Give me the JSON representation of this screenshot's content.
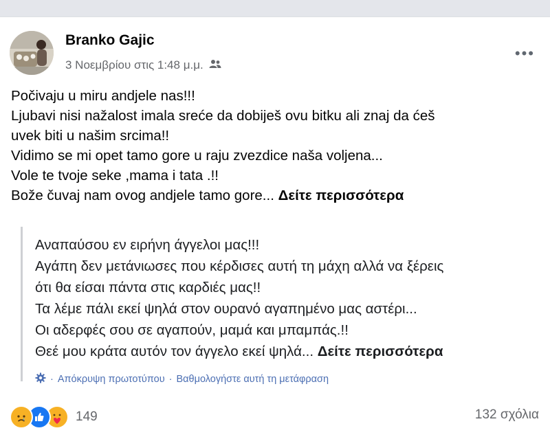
{
  "post": {
    "author": "Branko Gajic",
    "timestamp": "3 Νοεμβρίου στις 1:48 μ.μ.",
    "audience_icon": "friends-icon",
    "original_lines": [
      "Počivaju u miru andjele nas!!!",
      "Ljubavi nisi nažalost imala sreće da dobiješ ovu bitku ali znaj da ćeš",
      "uvek biti u našim srcima!!",
      "Vidimo se mi opet tamo gore u raju zvezdice naša voljena...",
      "Vole te tvoje seke ,mama i tata .!!",
      "Bože čuvaj nam ovog andjele tamo gore..."
    ],
    "see_more": "Δείτε περισσότερα"
  },
  "translation": {
    "lines": [
      "Αναπαύσου εν ειρήνη άγγελοι μας!!!",
      "Αγάπη δεν μετάνιωσες που κέρδισες αυτή τη μάχη αλλά να ξέρεις",
      "ότι θα είσαι πάντα στις καρδιές μας!!",
      "Τα λέμε πάλι εκεί ψηλά στον ουρανό αγαπημένο μας αστέρι...",
      "Οι αδερφές σου σε αγαπούν, μαμά και μπαμπάς.!!",
      "Θεέ μου κράτα αυτόν τον άγγελο εκεί ψηλά..."
    ],
    "see_more": "Δείτε περισσότερα",
    "hide_original": "Απόκρυψη πρωτοτύπου",
    "separator": "·",
    "rate_translation": "Βαθμολογήστε αυτή τη μετάφραση"
  },
  "footer": {
    "reaction_icons": [
      "sad-reaction-icon",
      "like-reaction-icon",
      "care-reaction-icon"
    ],
    "reaction_count": "149",
    "comments": "132 σχόλια"
  },
  "colors": {
    "link_blue": "#4c6fb3",
    "muted": "#65676b",
    "like_blue": "#1877f2",
    "reaction_yellow": "#f7b125"
  }
}
